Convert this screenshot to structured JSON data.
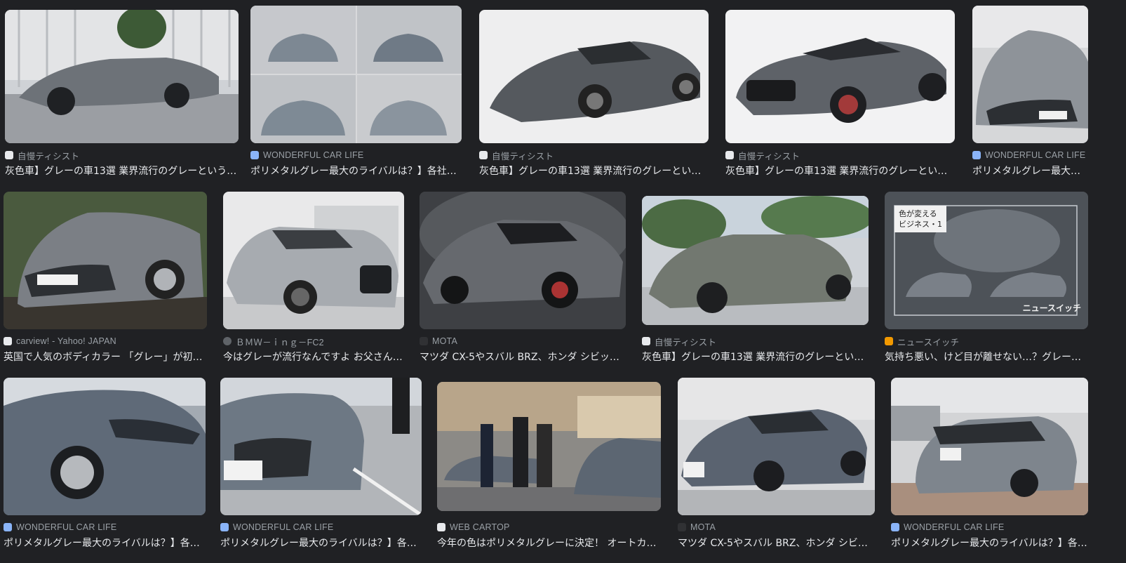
{
  "colors": {
    "background": "#202124",
    "source_text": "#9aa0a6",
    "title_text": "#e8eaed"
  },
  "rows": [
    {
      "cards": [
        {
          "source": "自慢ティシスト",
          "title": "灰色車】グレーの車13選 業界流行のグレーという…",
          "favicon": "jiman-favicon",
          "fav_color": "#e8eaed",
          "image": "gray-supercar-photo"
        },
        {
          "source": "WONDERFUL CAR LIFE",
          "title": "ポリメタルグレー最大のライバルは？】各社セ…",
          "favicon": "wcl-favicon",
          "fav_color": "#8ab4f8",
          "image": "gray-cars-collage-photo"
        },
        {
          "source": "自慢ティシスト",
          "title": "灰色車】グレーの車13選 業界流行のグレーという…",
          "favicon": "jiman-favicon",
          "fav_color": "#e8eaed",
          "image": "gray-mclaren-600lt-photo"
        },
        {
          "source": "自慢ティシスト",
          "title": "灰色車】グレーの車13選 業界流行のグレーという…",
          "favicon": "jiman-favicon",
          "fav_color": "#e8eaed",
          "image": "gray-audi-rs5-photo"
        },
        {
          "source": "WONDERFUL CAR LIFE",
          "title": "ポリメタルグレー最大の…",
          "favicon": "wcl-favicon",
          "fav_color": "#8ab4f8",
          "image": "gray-audi-rs6-avant-photo"
        }
      ]
    },
    {
      "cards": [
        {
          "source": "carview! - Yahoo! JAPAN",
          "title": "英国で人気のボディカラー 「グレー」が初の…",
          "favicon": "carview-favicon",
          "fav_color": "#e8eaed",
          "image": "gray-mercedes-a-class-photo"
        },
        {
          "source": "ＢＭＷ－ｉｎｇ－FC2",
          "title": "今はグレーが流行なんですよ お父さん…",
          "favicon": "globe-favicon",
          "fav_color": "#5f6368",
          "image": "gray-bmw-m4-photo"
        },
        {
          "source": "MOTA",
          "title": "マツダ CX-5やスバル BRZ、ホンダ シビック…",
          "favicon": "mota-favicon",
          "fav_color": "#303134",
          "image": "gray-toyota-supra-photo"
        },
        {
          "source": "自慢ティシスト",
          "title": "灰色車】グレーの車13選 業界流行のグレーという…",
          "favicon": "jiman-favicon",
          "fav_color": "#e8eaed",
          "image": "gray-lotus-elise-photo"
        },
        {
          "source": "ニュースイッチ",
          "title": "気持ち悪い、けど目が離せない…？グレーカ…",
          "favicon": "newswitch-favicon",
          "fav_color": "#f29900",
          "image": "newswitch-gray-cars-graphic",
          "overlay": "色が変える\nビジネス・1",
          "brand": "ニュースイッチ"
        }
      ]
    },
    {
      "cards": [
        {
          "source": "WONDERFUL CAR LIFE",
          "title": "ポリメタルグレー最大のライバルは？】各社…",
          "favicon": "wcl-favicon",
          "fav_color": "#8ab4f8",
          "image": "gray-mazda3-front-closeup-photo"
        },
        {
          "source": "WONDERFUL CAR LIFE",
          "title": "ポリメタルグレー最大のライバルは？】各社…",
          "favicon": "wcl-favicon",
          "fav_color": "#8ab4f8",
          "image": "gray-mazda3-parked-photo"
        },
        {
          "source": "WEB CARTOP",
          "title": "今年の色はポリメタルグレーに決定！ オートカラ…",
          "favicon": "cartop-favicon",
          "fav_color": "#e8eaed",
          "image": "award-ceremony-gray-cx30-photo"
        },
        {
          "source": "MOTA",
          "title": "マツダ CX-5やスバル BRZ、ホンダ シビック…",
          "favicon": "mota-favicon",
          "fav_color": "#303134",
          "image": "gray-mazda3-hatch-photo"
        },
        {
          "source": "WONDERFUL CAR LIFE",
          "title": "ポリメタルグレー最大のライバルは？】各…",
          "favicon": "wcl-favicon",
          "fav_color": "#8ab4f8",
          "image": "gray-honda-civic-rear-photo"
        }
      ]
    }
  ]
}
